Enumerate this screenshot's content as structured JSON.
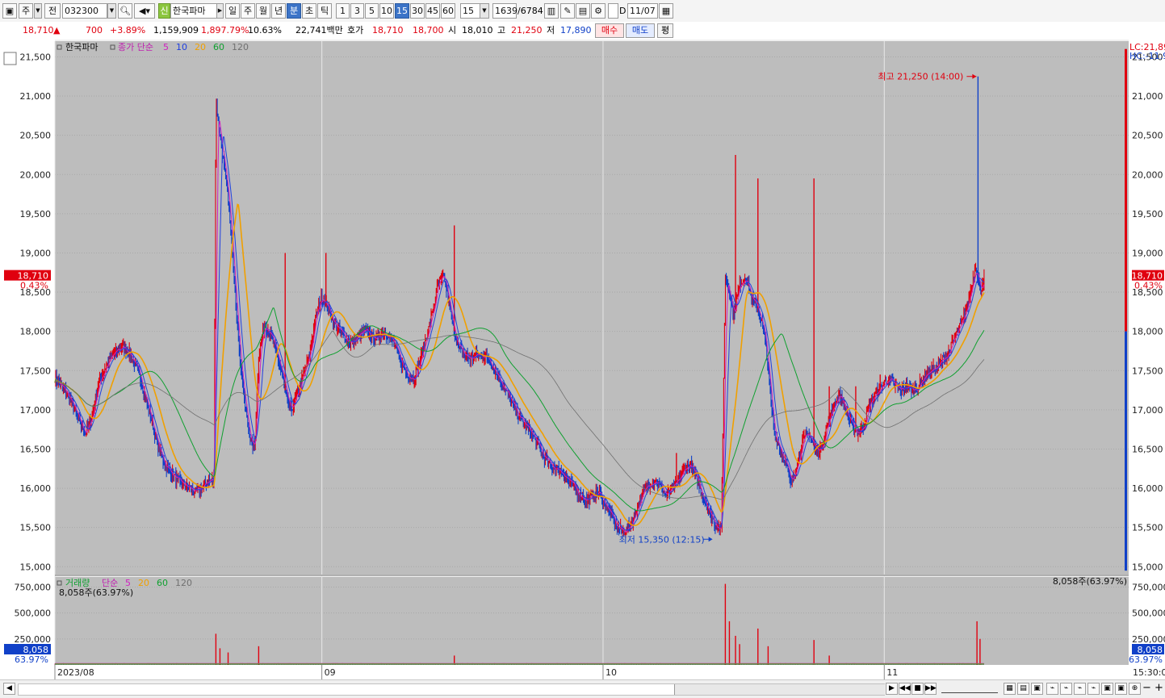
{
  "toolbar": {
    "market": "주",
    "prev_label": "전",
    "code": "032300",
    "badge": "신",
    "stock_name": "한국파마",
    "periods": [
      "일",
      "주",
      "월",
      "년",
      "분",
      "초",
      "틱"
    ],
    "active_period": "분",
    "intervals": [
      "1",
      "3",
      "5",
      "10",
      "15",
      "30",
      "45",
      "60"
    ],
    "active_interval": "15",
    "interval_value": "15",
    "count": "1639",
    "count_total": "/6784",
    "date": "11/07",
    "d_label": "D"
  },
  "info": {
    "price": "18,710",
    "change": "700",
    "change_pct": "+3.89%",
    "volume": "1,159,909",
    "volume_ratio": "1,897.79%",
    "turnover": "10.63%",
    "amount": "22,741백만",
    "quote_label": "호가",
    "ask": "18,710",
    "bid": "18,700",
    "open_label": "시",
    "open": "18,010",
    "high_label": "고",
    "high": "21,250",
    "low_label": "저",
    "low": "17,890",
    "buy_button": "매수",
    "sell_button": "매도",
    "eval_button": "평"
  },
  "chart_data": {
    "type": "line",
    "price_panel": {
      "name": "한국파마",
      "legend_prefix": "종가 단순",
      "ma_periods": [
        "5",
        "10",
        "20",
        "60",
        "120"
      ],
      "ma_colors": [
        "#d020c0",
        "#2040e0",
        "#f0a000",
        "#10a030",
        "#707070"
      ],
      "ylim": [
        14900,
        21700
      ],
      "y_ticks": [
        15000,
        15500,
        16000,
        16500,
        17000,
        17500,
        18000,
        18500,
        19000,
        19500,
        20000,
        20500,
        21000,
        21500
      ],
      "y_tick_labels": [
        "15,000",
        "15,500",
        "16,000",
        "16,500",
        "17,000",
        "17,500",
        "18,000",
        "18,500",
        "19,000",
        "19,500",
        "20,000",
        "20,500",
        "21,000",
        "21,500"
      ],
      "current_price": 18710,
      "current_price_label": "18,710",
      "current_pct_label": "0.43%",
      "lc_label": "LC:21,89",
      "hc_label": "HC:-11.9",
      "high_annotation": "최고 21,250 (14:00)",
      "low_annotation": "최저 15,350 (12:15)",
      "high_value": 21250,
      "low_value": 15350,
      "anchors": [
        [
          0,
          17400
        ],
        [
          0.006,
          17300
        ],
        [
          0.012,
          17200
        ],
        [
          0.018,
          17050
        ],
        [
          0.024,
          16850
        ],
        [
          0.03,
          16700
        ],
        [
          0.036,
          16900
        ],
        [
          0.042,
          17300
        ],
        [
          0.048,
          17500
        ],
        [
          0.054,
          17650
        ],
        [
          0.06,
          17750
        ],
        [
          0.066,
          17800
        ],
        [
          0.072,
          17750
        ],
        [
          0.078,
          17600
        ],
        [
          0.084,
          17400
        ],
        [
          0.09,
          17100
        ],
        [
          0.096,
          16800
        ],
        [
          0.102,
          16500
        ],
        [
          0.108,
          16300
        ],
        [
          0.114,
          16200
        ],
        [
          0.12,
          16100
        ],
        [
          0.126,
          16050
        ],
        [
          0.132,
          16000
        ],
        [
          0.138,
          15950
        ],
        [
          0.144,
          16000
        ],
        [
          0.15,
          16100
        ],
        [
          0.156,
          16100
        ],
        [
          0.158,
          20950
        ],
        [
          0.16,
          20700
        ],
        [
          0.164,
          20300
        ],
        [
          0.17,
          19700
        ],
        [
          0.176,
          18700
        ],
        [
          0.18,
          17900
        ],
        [
          0.186,
          17100
        ],
        [
          0.192,
          16600
        ],
        [
          0.196,
          16500
        ],
        [
          0.2,
          17700
        ],
        [
          0.206,
          18100
        ],
        [
          0.212,
          17950
        ],
        [
          0.218,
          17700
        ],
        [
          0.224,
          17400
        ],
        [
          0.228,
          17100
        ],
        [
          0.232,
          17000
        ],
        [
          0.238,
          17200
        ],
        [
          0.244,
          17450
        ],
        [
          0.25,
          17700
        ],
        [
          0.256,
          18200
        ],
        [
          0.262,
          18450
        ],
        [
          0.268,
          18300
        ],
        [
          0.274,
          18100
        ],
        [
          0.28,
          18000
        ],
        [
          0.286,
          17900
        ],
        [
          0.292,
          17850
        ],
        [
          0.298,
          17950
        ],
        [
          0.304,
          18000
        ],
        [
          0.31,
          17950
        ],
        [
          0.316,
          17900
        ],
        [
          0.322,
          18000
        ],
        [
          0.328,
          17950
        ],
        [
          0.334,
          17800
        ],
        [
          0.34,
          17600
        ],
        [
          0.346,
          17450
        ],
        [
          0.352,
          17400
        ],
        [
          0.358,
          17600
        ],
        [
          0.364,
          17900
        ],
        [
          0.37,
          18200
        ],
        [
          0.376,
          18600
        ],
        [
          0.382,
          18700
        ],
        [
          0.386,
          18400
        ],
        [
          0.39,
          18100
        ],
        [
          0.396,
          17800
        ],
        [
          0.402,
          17700
        ],
        [
          0.408,
          17650
        ],
        [
          0.414,
          17700
        ],
        [
          0.42,
          17700
        ],
        [
          0.426,
          17650
        ],
        [
          0.432,
          17500
        ],
        [
          0.438,
          17350
        ],
        [
          0.444,
          17200
        ],
        [
          0.45,
          17050
        ],
        [
          0.456,
          16900
        ],
        [
          0.462,
          16800
        ],
        [
          0.468,
          16700
        ],
        [
          0.474,
          16550
        ],
        [
          0.48,
          16400
        ],
        [
          0.486,
          16300
        ],
        [
          0.492,
          16250
        ],
        [
          0.498,
          16200
        ],
        [
          0.504,
          16100
        ],
        [
          0.51,
          16000
        ],
        [
          0.516,
          15900
        ],
        [
          0.522,
          15850
        ],
        [
          0.528,
          15900
        ],
        [
          0.534,
          15950
        ],
        [
          0.54,
          15800
        ],
        [
          0.546,
          15650
        ],
        [
          0.552,
          15500
        ],
        [
          0.558,
          15450
        ],
        [
          0.564,
          15500
        ],
        [
          0.57,
          15700
        ],
        [
          0.576,
          15900
        ],
        [
          0.582,
          16050
        ],
        [
          0.588,
          16100
        ],
        [
          0.594,
          16050
        ],
        [
          0.6,
          15900
        ],
        [
          0.606,
          16000
        ],
        [
          0.612,
          16100
        ],
        [
          0.618,
          16250
        ],
        [
          0.624,
          16300
        ],
        [
          0.63,
          16100
        ],
        [
          0.636,
          15900
        ],
        [
          0.642,
          15700
        ],
        [
          0.648,
          15550
        ],
        [
          0.654,
          15450
        ],
        [
          0.658,
          18700
        ],
        [
          0.662,
          18500
        ],
        [
          0.666,
          18200
        ],
        [
          0.672,
          18600
        ],
        [
          0.678,
          18700
        ],
        [
          0.684,
          18400
        ],
        [
          0.69,
          18300
        ],
        [
          0.694,
          18100
        ],
        [
          0.698,
          17800
        ],
        [
          0.702,
          17200
        ],
        [
          0.706,
          16700
        ],
        [
          0.712,
          16500
        ],
        [
          0.718,
          16300
        ],
        [
          0.722,
          16050
        ],
        [
          0.728,
          16300
        ],
        [
          0.734,
          16600
        ],
        [
          0.74,
          16700
        ],
        [
          0.746,
          16500
        ],
        [
          0.752,
          16500
        ],
        [
          0.758,
          16800
        ],
        [
          0.764,
          17050
        ],
        [
          0.77,
          17200
        ],
        [
          0.776,
          17000
        ],
        [
          0.782,
          16800
        ],
        [
          0.788,
          16700
        ],
        [
          0.794,
          16800
        ],
        [
          0.8,
          17100
        ],
        [
          0.806,
          17200
        ],
        [
          0.812,
          17300
        ],
        [
          0.818,
          17400
        ],
        [
          0.824,
          17300
        ],
        [
          0.83,
          17250
        ],
        [
          0.836,
          17300
        ],
        [
          0.842,
          17250
        ],
        [
          0.848,
          17300
        ],
        [
          0.854,
          17450
        ],
        [
          0.86,
          17500
        ],
        [
          0.866,
          17550
        ],
        [
          0.872,
          17650
        ],
        [
          0.878,
          17750
        ],
        [
          0.884,
          17950
        ],
        [
          0.89,
          18100
        ],
        [
          0.896,
          18350
        ],
        [
          0.9,
          18600
        ],
        [
          0.904,
          18850
        ],
        [
          0.908,
          18500
        ],
        [
          0.912,
          18700
        ]
      ],
      "spikes": [
        [
          0.158,
          20950
        ],
        [
          0.226,
          19000
        ],
        [
          0.266,
          19000
        ],
        [
          0.392,
          19350
        ],
        [
          0.61,
          16450
        ],
        [
          0.668,
          20250
        ],
        [
          0.69,
          19950
        ],
        [
          0.745,
          19950
        ],
        [
          0.76,
          17300
        ],
        [
          0.786,
          17300
        ],
        [
          0.81,
          17450
        ],
        [
          0.906,
          21250
        ]
      ]
    },
    "volume_panel": {
      "name": "거래량",
      "legend_prefix": "단순",
      "ma_periods": [
        "5",
        "20",
        "60",
        "120"
      ],
      "ma_colors": [
        "#d020c0",
        "#f0a000",
        "#10a030",
        "#707070"
      ],
      "ylim": [
        0,
        800000
      ],
      "y_ticks": [
        250000,
        500000,
        750000
      ],
      "y_tick_labels": [
        "250,000",
        "500,000",
        "750,000"
      ],
      "current_volume_label": "8,058",
      "current_pct_label": "63.97%",
      "header_text": "8,058주(63.97%)",
      "spikes": [
        [
          0.158,
          300000
        ],
        [
          0.162,
          160000
        ],
        [
          0.17,
          120000
        ],
        [
          0.2,
          180000
        ],
        [
          0.392,
          90000
        ],
        [
          0.658,
          780000
        ],
        [
          0.662,
          420000
        ],
        [
          0.668,
          280000
        ],
        [
          0.672,
          200000
        ],
        [
          0.69,
          350000
        ],
        [
          0.7,
          180000
        ],
        [
          0.745,
          240000
        ],
        [
          0.76,
          90000
        ],
        [
          0.905,
          420000
        ],
        [
          0.908,
          250000
        ]
      ]
    },
    "x_axis": {
      "labels": [
        "2023/08",
        "09",
        "10",
        "11"
      ],
      "label_positions": [
        0,
        0.262,
        0.538,
        0.814
      ],
      "end_label": "15:30:0"
    },
    "colors": {
      "up": "#e0000f",
      "down": "#1040c8",
      "background": "#bdbdbd",
      "axis_bg": "#ffffff"
    }
  }
}
